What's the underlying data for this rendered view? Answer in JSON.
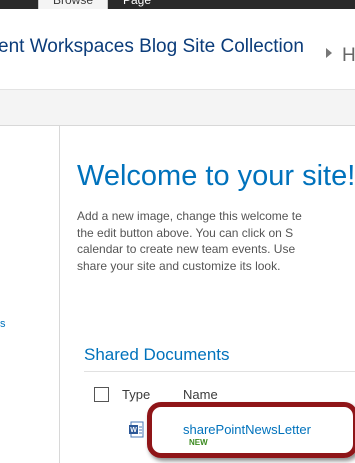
{
  "ribbon": {
    "tabs": [
      {
        "label": "Browse"
      },
      {
        "label": "Page"
      }
    ]
  },
  "header": {
    "site_title": "ent Workspaces Blog Site Collection",
    "breadcrumb_next": "H"
  },
  "quick_launch": {
    "fragment": "s"
  },
  "main": {
    "welcome_title": "Welcome to your site!",
    "welcome_lines": [
      "Add a new image, change this welcome te",
      "the edit button above. You can click on S",
      "calendar to create new team events. Use",
      "share your site and customize its look."
    ]
  },
  "shared_documents": {
    "title": "Shared Documents",
    "columns": {
      "type": "Type",
      "name": "Name"
    },
    "items": [
      {
        "name": "sharePointNewsLetter",
        "badge": "NEW",
        "icon": "word-document-icon"
      }
    ]
  },
  "colors": {
    "accent": "#0072bc",
    "ribbon": "#2a2a2a",
    "highlight": "#8f1518"
  }
}
